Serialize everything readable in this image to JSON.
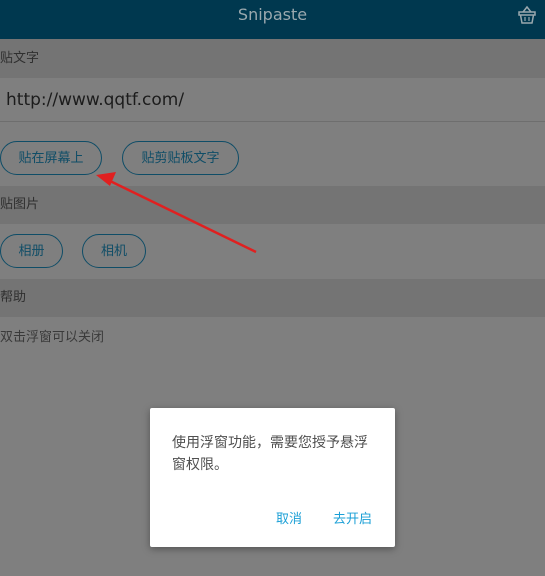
{
  "appbar": {
    "title": "Snipaste",
    "icon": "basket-icon"
  },
  "text_section": {
    "header": "贴文字",
    "input_value": "http://www.qqtf.com/",
    "buttons": {
      "paste_screen": "贴在屏幕上",
      "paste_clipboard": "贴剪贴板文字"
    }
  },
  "image_section": {
    "header": "贴图片",
    "buttons": {
      "album": "相册",
      "camera": "相机"
    }
  },
  "help_section": {
    "header": "帮助",
    "tip": "双击浮窗可以关闭"
  },
  "dialog": {
    "message": "使用浮窗功能，需要您授予悬浮窗权限。",
    "cancel": "取消",
    "confirm": "去开启"
  },
  "colors": {
    "appbar": "#00384f",
    "accent": "#1a9fd6",
    "arrow": "#e02020",
    "pill_border": "#0f4d67"
  }
}
